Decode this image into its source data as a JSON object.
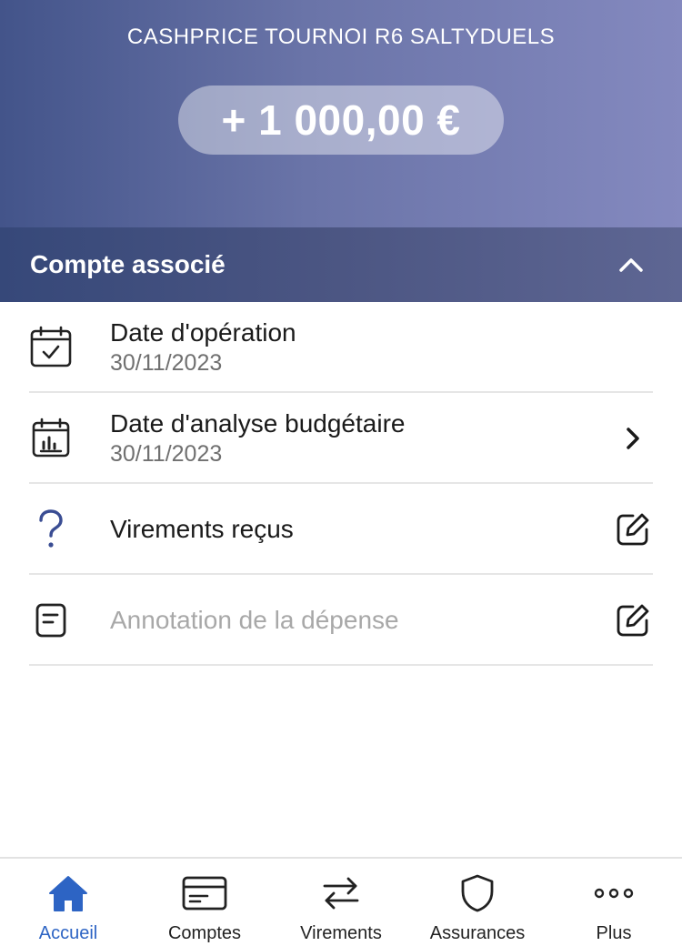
{
  "header": {
    "title": "CASHPRICE TOURNOI R6 SALTYDUELS",
    "amount": "+ 1 000,00 €"
  },
  "section": {
    "title": "Compte associé",
    "toggle_icon": "chevron-up-icon"
  },
  "rows": [
    {
      "icon": "calendar-check-icon",
      "title": "Date d'opération",
      "subtitle": "30/11/2023"
    },
    {
      "icon": "calendar-chart-icon",
      "title": "Date d'analyse budgétaire",
      "subtitle": "30/11/2023",
      "action_icon": "chevron-right-icon"
    },
    {
      "icon": "question-icon",
      "title": "Virements reçus",
      "action_icon": "edit-icon"
    },
    {
      "icon": "note-icon",
      "placeholder": "Annotation de la dépense",
      "action_icon": "edit-icon"
    }
  ],
  "tabbar": {
    "tabs": [
      {
        "label": "Accueil",
        "icon": "home-icon",
        "active": true
      },
      {
        "label": "Comptes",
        "icon": "card-icon",
        "active": false
      },
      {
        "label": "Virements",
        "icon": "transfer-icon",
        "active": false
      },
      {
        "label": "Assurances",
        "icon": "shield-icon",
        "active": false
      },
      {
        "label": "Plus",
        "icon": "more-icon",
        "active": false
      }
    ]
  },
  "colors": {
    "header_gradient_start": "#43548a",
    "header_gradient_end": "#8489bf",
    "section_bg": "#3f4d7e",
    "accent_blue": "#2d64c4",
    "icon_blue": "#3a4d93"
  }
}
